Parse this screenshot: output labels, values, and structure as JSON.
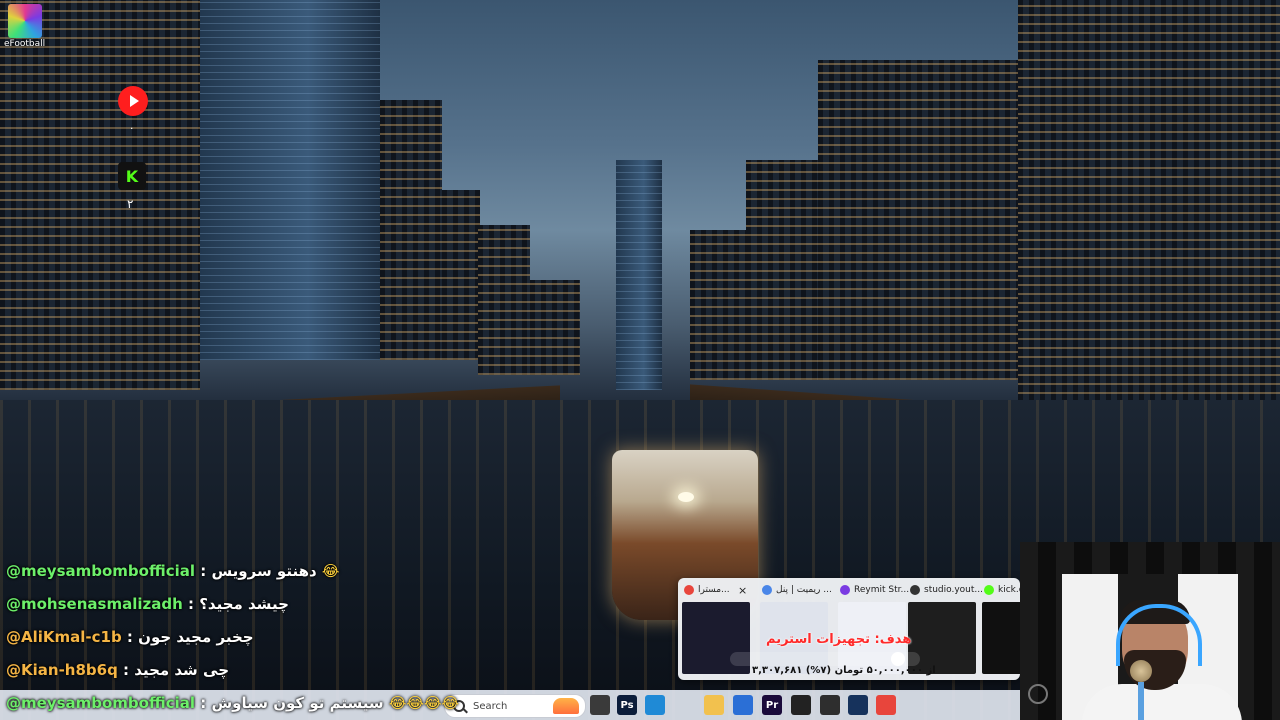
{
  "desktop": {
    "efootball_label": "eFootball",
    "youtube_count": "۰",
    "kick_count": "۲"
  },
  "chat": {
    "messages": [
      {
        "user": "@meysambombofficial",
        "sep": " : ",
        "text": "دهنتو سرویس",
        "emoji": "😂"
      },
      {
        "user": "@mohsenasmalizadh",
        "sep": " : ",
        "text": "چیشد مجید؟",
        "emoji": ""
      },
      {
        "user": "@AliKmal-c1b",
        "sep": " : ",
        "text": "چخبر مجید جون",
        "emoji": ""
      },
      {
        "user": "@Kian-h8b6q",
        "sep": " : ",
        "text": "چی شد مجید",
        "emoji": ""
      },
      {
        "user": "@meysambombofficial",
        "sep": " : ",
        "text": "سیستم تو کون سیاوش",
        "emoji": "😂😂😂😂"
      }
    ]
  },
  "taskbar": {
    "search_placeholder": "Search",
    "apps": [
      {
        "icon": "task-view-icon",
        "color": "#3a3a3a",
        "label": ""
      },
      {
        "icon": "photoshop-icon",
        "color": "#0b1d3a",
        "label": "Ps"
      },
      {
        "icon": "edge-icon",
        "color": "#1f8ad6",
        "label": ""
      },
      {
        "icon": "file-explorer-icon",
        "color": "#f2c14e",
        "label": ""
      },
      {
        "icon": "microsoft-store-icon",
        "color": "#2b6fd6",
        "label": ""
      },
      {
        "icon": "premiere-icon",
        "color": "#1a0a3a",
        "label": "Pr"
      },
      {
        "icon": "capcut-icon",
        "color": "#222222",
        "label": ""
      },
      {
        "icon": "obs-icon",
        "color": "#2e2e2e",
        "label": ""
      },
      {
        "icon": "steam-icon",
        "color": "#16325c",
        "label": ""
      },
      {
        "icon": "chrome-icon",
        "color": "#e8453c",
        "label": ""
      }
    ]
  },
  "popup": {
    "tabs": [
      {
        "title": "مسترا...",
        "favicon_color": "#e8453c",
        "thumb_color": "#1b1b2e",
        "icon": "chrome-icon"
      },
      {
        "title": "ریمیت | پنل ...",
        "favicon_color": "#4a86e8",
        "thumb_color": "#dfe3ec",
        "icon": "chrome-icon"
      },
      {
        "title": "Reymit Str...",
        "favicon_color": "#7a3be2",
        "thumb_color": "#eef0f6",
        "icon": "reymit-icon"
      },
      {
        "title": "studio.yout...",
        "favicon_color": "#333333",
        "thumb_color": "#1e1e1e",
        "icon": "obs-icon"
      },
      {
        "title": "kick.c...",
        "favicon_color": "#53fc18",
        "thumb_color": "#101010",
        "icon": "kick-icon"
      }
    ],
    "close_symbol": "×"
  },
  "goal": {
    "title": "هدف: تجهیزات استریم",
    "progress_text": "۳,۳۰۷,۶۸۱ از ۵۰,۰۰۰,۰۰۰ تومان (۷%)",
    "progress_fraction": 0.07
  }
}
